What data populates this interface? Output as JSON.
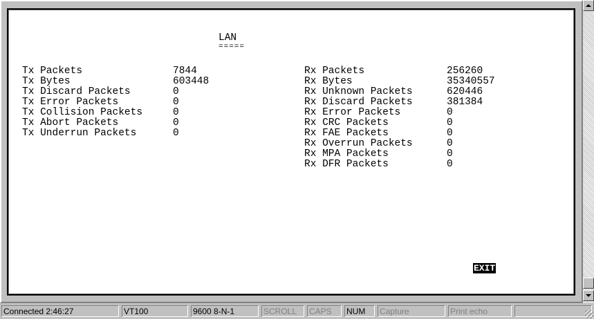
{
  "screen": {
    "title": "LAN",
    "title_underline": "=====",
    "tx_stats": [
      {
        "label": "Tx Packets",
        "value": "7844"
      },
      {
        "label": "Tx Bytes",
        "value": "603448"
      },
      {
        "label": "Tx Discard Packets",
        "value": "0"
      },
      {
        "label": "Tx Error Packets",
        "value": "0"
      },
      {
        "label": "Tx Collision Packets",
        "value": "0"
      },
      {
        "label": "Tx Abort Packets",
        "value": "0"
      },
      {
        "label": "Tx Underrun Packets",
        "value": "0"
      }
    ],
    "rx_stats": [
      {
        "label": "Rx Packets",
        "value": "256260"
      },
      {
        "label": "Rx Bytes",
        "value": "35340557"
      },
      {
        "label": "Rx Unknown Packets",
        "value": "620446"
      },
      {
        "label": "Rx Discard Packets",
        "value": "381384"
      },
      {
        "label": "Rx Error Packets",
        "value": "0"
      },
      {
        "label": "Rx CRC Packets",
        "value": "0"
      },
      {
        "label": "Rx FAE Packets",
        "value": "0"
      },
      {
        "label": "Rx Overrun Packets",
        "value": "0"
      },
      {
        "label": "Rx MPA Packets",
        "value": "0"
      },
      {
        "label": "Rx DFR Packets",
        "value": "0"
      }
    ],
    "exit_label": "EXIT"
  },
  "status_bar": {
    "connection": "Connected 2:46:27",
    "emulation": "VT100",
    "port_settings": "9600 8-N-1",
    "scroll": "SCROLL",
    "caps": "CAPS",
    "num": "NUM",
    "capture": "Capture",
    "print_echo": "Print echo"
  },
  "scrollbar": {
    "up_icon": "arrow-up-icon",
    "down_icon": "arrow-down-icon"
  }
}
